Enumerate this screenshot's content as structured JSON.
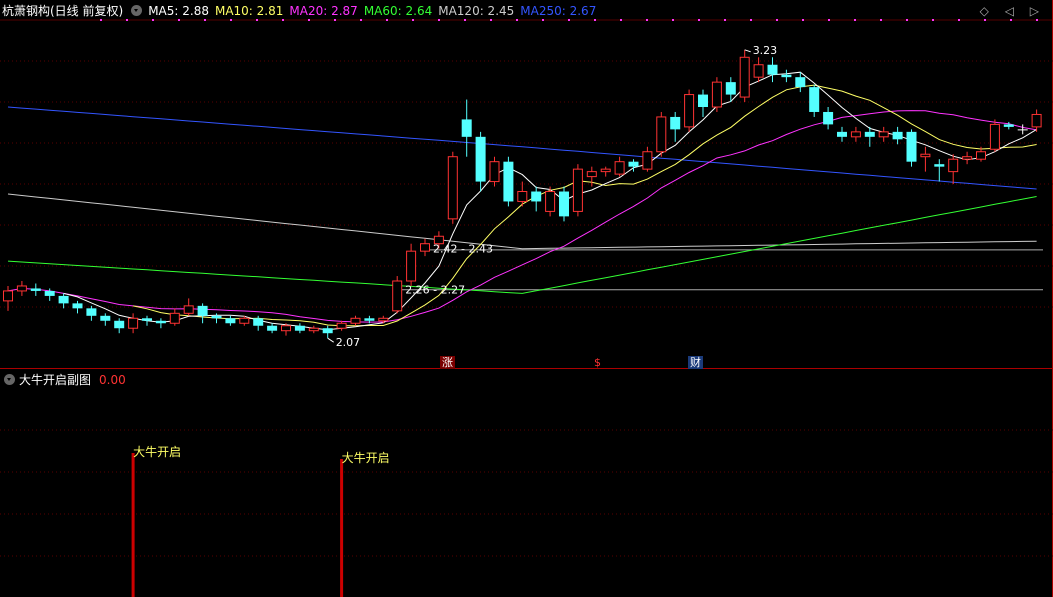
{
  "header": {
    "stock_title": "杭萧钢构(日线 前复权)",
    "ma_labels": [
      {
        "label": "MA5: 2.88",
        "color": "#ffffff"
      },
      {
        "label": "MA10: 2.81",
        "color": "#ffff66"
      },
      {
        "label": "MA20: 2.87",
        "color": "#ff33ff"
      },
      {
        "label": "MA60: 2.64",
        "color": "#33ff33"
      },
      {
        "label": "MA120: 2.45",
        "color": "#cccccc"
      },
      {
        "label": "MA250: 2.67",
        "color": "#3355ff"
      }
    ],
    "nav_glyphs": "◇ ◁ ▷"
  },
  "sub_panel": {
    "title": "大牛开启副图",
    "value": "0.00",
    "value_color": "#ff3333"
  },
  "badges": [
    {
      "text": "涨",
      "color": "#ffffff",
      "bg": "#7a0000"
    },
    {
      "text": "$",
      "color": "#ff3333",
      "bg": "transparent"
    },
    {
      "text": "财",
      "color": "#ffffff",
      "bg": "#1a3a7a"
    }
  ],
  "chart_data": {
    "type": "candlestick",
    "colors": {
      "up": "#ff3333",
      "down": "#54ffff",
      "doji": "#ffffff",
      "signal": "#cc0000",
      "signal_text": "#ffff66"
    },
    "ylim": [
      1.95,
      3.35
    ],
    "price_annotations": [
      {
        "text": "3.23",
        "index": 53
      },
      {
        "text": "2.07",
        "index": 23
      },
      {
        "text": "2.42 - 2.43",
        "index": 30
      },
      {
        "text": "2.26 - 2.27",
        "index": 28
      }
    ],
    "candles": [
      [
        2.22,
        2.26,
        2.28,
        2.18
      ],
      [
        2.26,
        2.28,
        2.3,
        2.24
      ],
      [
        2.27,
        2.26,
        2.29,
        2.24
      ],
      [
        2.26,
        2.24,
        2.27,
        2.22
      ],
      [
        2.24,
        2.21,
        2.25,
        2.19
      ],
      [
        2.21,
        2.19,
        2.22,
        2.17
      ],
      [
        2.19,
        2.16,
        2.2,
        2.14
      ],
      [
        2.16,
        2.14,
        2.17,
        2.12
      ],
      [
        2.14,
        2.11,
        2.15,
        2.09
      ],
      [
        2.11,
        2.15,
        2.17,
        2.09
      ],
      [
        2.15,
        2.14,
        2.16,
        2.12
      ],
      [
        2.14,
        2.13,
        2.15,
        2.11
      ],
      [
        2.13,
        2.17,
        2.19,
        2.12
      ],
      [
        2.17,
        2.2,
        2.23,
        2.16
      ],
      [
        2.2,
        2.16,
        2.21,
        2.13
      ],
      [
        2.16,
        2.15,
        2.17,
        2.13
      ],
      [
        2.15,
        2.13,
        2.16,
        2.12
      ],
      [
        2.13,
        2.15,
        2.16,
        2.12
      ],
      [
        2.15,
        2.12,
        2.16,
        2.1
      ],
      [
        2.12,
        2.1,
        2.13,
        2.09
      ],
      [
        2.1,
        2.12,
        2.13,
        2.08
      ],
      [
        2.12,
        2.1,
        2.13,
        2.09
      ],
      [
        2.1,
        2.11,
        2.12,
        2.09
      ],
      [
        2.11,
        2.09,
        2.12,
        2.07
      ],
      [
        2.11,
        2.13,
        2.14,
        2.1
      ],
      [
        2.13,
        2.15,
        2.16,
        2.12
      ],
      [
        2.15,
        2.14,
        2.16,
        2.13
      ],
      [
        2.14,
        2.15,
        2.16,
        2.13
      ],
      [
        2.18,
        2.3,
        2.32,
        2.17
      ],
      [
        2.3,
        2.42,
        2.45,
        2.28
      ],
      [
        2.42,
        2.45,
        2.47,
        2.4
      ],
      [
        2.45,
        2.48,
        2.5,
        2.43
      ],
      [
        2.55,
        2.8,
        2.82,
        2.53
      ],
      [
        2.95,
        2.88,
        3.03,
        2.8
      ],
      [
        2.88,
        2.7,
        2.9,
        2.66
      ],
      [
        2.7,
        2.78,
        2.8,
        2.68
      ],
      [
        2.78,
        2.62,
        2.8,
        2.6
      ],
      [
        2.62,
        2.66,
        2.7,
        2.6
      ],
      [
        2.66,
        2.62,
        2.68,
        2.58
      ],
      [
        2.58,
        2.66,
        2.68,
        2.56
      ],
      [
        2.66,
        2.56,
        2.68,
        2.54
      ],
      [
        2.58,
        2.75,
        2.77,
        2.56
      ],
      [
        2.72,
        2.74,
        2.76,
        2.68
      ],
      [
        2.74,
        2.75,
        2.76,
        2.72
      ],
      [
        2.73,
        2.78,
        2.8,
        2.72
      ],
      [
        2.78,
        2.76,
        2.79,
        2.74
      ],
      [
        2.75,
        2.82,
        2.84,
        2.74
      ],
      [
        2.82,
        2.96,
        2.98,
        2.8
      ],
      [
        2.96,
        2.91,
        2.98,
        2.86
      ],
      [
        2.92,
        3.05,
        3.07,
        2.9
      ],
      [
        3.05,
        3.0,
        3.07,
        2.96
      ],
      [
        3.0,
        3.1,
        3.12,
        2.98
      ],
      [
        3.1,
        3.05,
        3.12,
        3.02
      ],
      [
        3.04,
        3.2,
        3.23,
        3.02
      ],
      [
        3.12,
        3.17,
        3.2,
        3.1
      ],
      [
        3.17,
        3.13,
        3.2,
        3.1
      ],
      [
        3.13,
        3.12,
        3.15,
        3.1
      ],
      [
        3.12,
        3.08,
        3.14,
        3.06
      ],
      [
        3.08,
        2.98,
        3.09,
        2.96
      ],
      [
        2.98,
        2.93,
        3.0,
        2.91
      ],
      [
        2.9,
        2.88,
        2.92,
        2.86
      ],
      [
        2.88,
        2.9,
        2.92,
        2.86
      ],
      [
        2.9,
        2.88,
        2.92,
        2.84
      ],
      [
        2.88,
        2.9,
        2.92,
        2.86
      ],
      [
        2.9,
        2.87,
        2.92,
        2.85
      ],
      [
        2.9,
        2.78,
        2.91,
        2.76
      ],
      [
        2.8,
        2.81,
        2.84,
        2.74
      ],
      [
        2.77,
        2.76,
        2.79,
        2.7
      ],
      [
        2.74,
        2.79,
        2.81,
        2.69
      ],
      [
        2.79,
        2.8,
        2.82,
        2.77
      ],
      [
        2.79,
        2.82,
        2.84,
        2.78
      ],
      [
        2.83,
        2.93,
        2.95,
        2.82
      ],
      [
        2.93,
        2.92,
        2.94,
        2.91
      ],
      [
        2.91,
        2.91,
        2.93,
        2.89
      ],
      [
        2.92,
        2.97,
        2.99,
        2.9
      ]
    ],
    "signals": [
      {
        "index": 9,
        "label": "大牛开启"
      },
      {
        "index": 24,
        "label": "大牛开启"
      }
    ]
  }
}
